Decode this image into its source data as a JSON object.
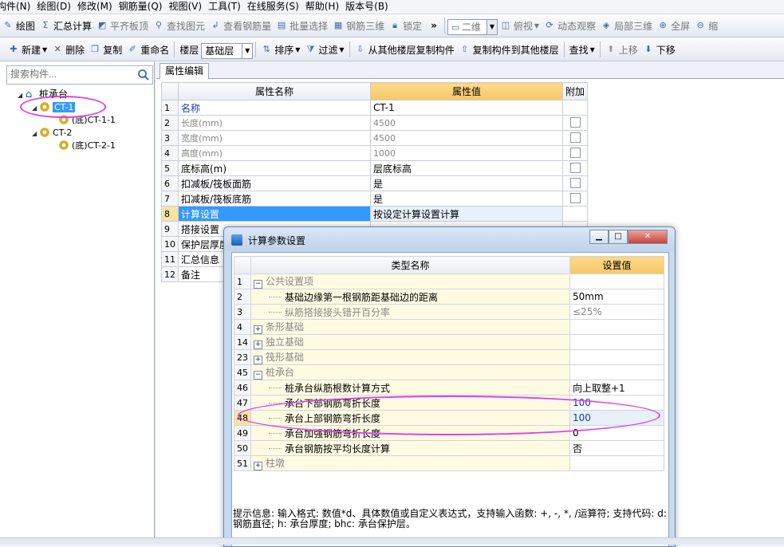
{
  "menubar": {
    "items": [
      "构件(N)",
      "绘图(D)",
      "修改(M)",
      "钢筋量(Q)",
      "视图(V)",
      "工具(T)",
      "在线服务(S)",
      "帮助(H)",
      "版本号(B)"
    ]
  },
  "toolbar1": {
    "draw": "绘图",
    "sum_calc": "汇总计算",
    "flush_slab": "平齐板顶",
    "find_element": "查找图元",
    "view_rebar": "查看钢筋量",
    "batch_select": "批量选择",
    "rebar_3d": "钢筋三维",
    "lock": "锁定",
    "view_mode": "二维",
    "top_view": "俯视",
    "dynamic_view": "动态观察",
    "local_3d": "局部三维",
    "fullscreen": "全屏",
    "zoom_out": "缩"
  },
  "toolbar2": {
    "new": "新建",
    "delete": "删除",
    "copy": "复制",
    "rename": "重命名",
    "floor_label": "楼层",
    "floor_value": "基础层",
    "sort": "排序",
    "filter": "过滤",
    "copy_from_floor": "从其他楼层复制构件",
    "copy_to_floor": "复制构件到其他楼层",
    "find": "查找",
    "move_up": "上移",
    "move_down": "下移"
  },
  "left": {
    "search_placeholder": "搜索构件...",
    "tree": {
      "root": "桩承台",
      "items": [
        {
          "label": "CT-1",
          "child": "(底)CT-1-1"
        },
        {
          "label": "CT-2",
          "child": "(底)CT-2-1"
        }
      ]
    }
  },
  "attr": {
    "tab": "属性编辑",
    "col_name": "属性名称",
    "col_value": "属性值",
    "col_extra": "附加",
    "rows": [
      {
        "n": "1",
        "name": "名称",
        "value": "CT-1",
        "gray": false,
        "check": false
      },
      {
        "n": "2",
        "name": "长度(mm)",
        "value": "4500",
        "gray": true,
        "check": true
      },
      {
        "n": "3",
        "name": "宽度(mm)",
        "value": "4500",
        "gray": true,
        "check": true
      },
      {
        "n": "4",
        "name": "高度(mm)",
        "value": "1000",
        "gray": true,
        "check": true
      },
      {
        "n": "5",
        "name": "底标高(m)",
        "value": "层底标高",
        "gray": false,
        "check": true
      },
      {
        "n": "6",
        "name": "扣减板/筏板面筋",
        "value": "是",
        "gray": false,
        "check": true
      },
      {
        "n": "7",
        "name": "扣减板/筏板底筋",
        "value": "是",
        "gray": false,
        "check": true
      },
      {
        "n": "8",
        "name": "计算设置",
        "value": "按设定计算设置计算",
        "gray": false,
        "check": false
      },
      {
        "n": "9",
        "name": "搭接设置",
        "value": "",
        "gray": false,
        "check": false
      },
      {
        "n": "10",
        "name": "保护层厚度",
        "value": "",
        "gray": false,
        "check": false
      },
      {
        "n": "11",
        "name": "汇总信息",
        "value": "",
        "gray": false,
        "check": false
      },
      {
        "n": "12",
        "name": "备注",
        "value": "",
        "gray": false,
        "check": false
      }
    ]
  },
  "dialog": {
    "title": "计算参数设置",
    "col_type": "类型名称",
    "col_value": "设置值",
    "rows": [
      {
        "n": "1",
        "name": "公共设置项",
        "value": "",
        "kind": "group-open"
      },
      {
        "n": "2",
        "name": "基础边缘第一根钢筋距基础边的距离",
        "value": "50mm",
        "kind": "child"
      },
      {
        "n": "3",
        "name": "纵筋搭接接头错开百分率",
        "value": "≤25%",
        "kind": "child-gray"
      },
      {
        "n": "4",
        "name": "条形基础",
        "value": "",
        "kind": "group-closed"
      },
      {
        "n": "14",
        "name": "独立基础",
        "value": "",
        "kind": "group-closed"
      },
      {
        "n": "23",
        "name": "筏形基础",
        "value": "",
        "kind": "group-closed"
      },
      {
        "n": "45",
        "name": "桩承台",
        "value": "",
        "kind": "group-open"
      },
      {
        "n": "46",
        "name": "桩承台纵筋根数计算方式",
        "value": "向上取整+1",
        "kind": "child"
      },
      {
        "n": "47",
        "name": "承台下部钢筋弯折长度",
        "value": "100",
        "kind": "child-val"
      },
      {
        "n": "48",
        "name": "承台上部钢筋弯折长度",
        "value": "100",
        "kind": "child-sel"
      },
      {
        "n": "49",
        "name": "承台加强钢筋弯折长度",
        "value": "0",
        "kind": "child"
      },
      {
        "n": "50",
        "name": "承台钢筋按平均长度计算",
        "value": "否",
        "kind": "child"
      },
      {
        "n": "51",
        "name": "柱墩",
        "value": "",
        "kind": "group-closed"
      }
    ],
    "hint": "提示信息: 输入格式: 数值*d、具体数值或自定义表达式，支持输入函数: +, -, *, /运算符; 支持代码: d: 钢筋直径; h: 承台厚度; bhc: 承台保护层。"
  },
  "colors": {
    "accent_header": "#f6c766",
    "selection": "#3399ff",
    "annotation": "#e040e8"
  }
}
